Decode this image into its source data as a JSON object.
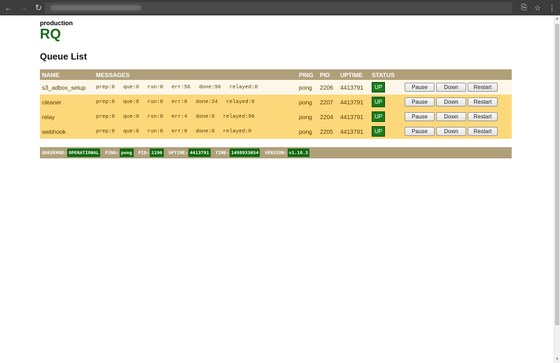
{
  "browser": {
    "back_icon": "←",
    "forward_icon": "→",
    "reload_icon": "↻",
    "translate_icon": "⎘",
    "star_icon": "☆",
    "menu_icon": "⋮"
  },
  "header": {
    "environment": "production",
    "brand": "RQ"
  },
  "section_title": "Queue List",
  "table": {
    "columns": {
      "name": "NAME",
      "messages": "MESSAGES",
      "ping": "PING",
      "pid": "PID",
      "uptime": "UPTIME",
      "status": "STATUS"
    },
    "button_labels": {
      "pause": "Pause",
      "down": "Down",
      "restart": "Restart"
    },
    "rows": [
      {
        "name": "s3_adbox_setup",
        "prep": "prep:0",
        "que": "que:0",
        "run": "run:0",
        "err": "err:56",
        "done": "done:96",
        "relayed": "relayed:0",
        "ping": "pong",
        "pid": "2206",
        "uptime": "4413791",
        "status": "UP"
      },
      {
        "name": "cleaner",
        "prep": "prep:0",
        "que": "que:0",
        "run": "run:0",
        "err": "err:0",
        "done": "done:24",
        "relayed": "relayed:0",
        "ping": "pong",
        "pid": "2207",
        "uptime": "4413791",
        "status": "UP"
      },
      {
        "name": "relay",
        "prep": "prep:0",
        "que": "que:0",
        "run": "run:0",
        "err": "err:4",
        "done": "done:0",
        "relayed": "relayed:96",
        "ping": "pong",
        "pid": "2204",
        "uptime": "4413791",
        "status": "UP"
      },
      {
        "name": "webhook",
        "prep": "prep:0",
        "que": "que:0",
        "run": "run:0",
        "err": "err:0",
        "done": "done:0",
        "relayed": "relayed:0",
        "ping": "pong",
        "pid": "2205",
        "uptime": "4413791",
        "status": "UP"
      }
    ]
  },
  "status_bar": {
    "queuemgr_label": "QUEUEMGR:",
    "queuemgr_value": "OPERATIONAL",
    "ping_label": "PING:",
    "ping_value": "pong",
    "pid_label": "PID:",
    "pid_value": "2190",
    "uptime_label": "UPTIME:",
    "uptime_value": "4413791",
    "time_label": "TIME:",
    "time_value": "1498933054",
    "version_label": "VERSION:",
    "version_value": "v1.18.3"
  },
  "colors": {
    "accent_green": "#1a6a1a",
    "header_tan": "#b0a07a",
    "row_orange": "#fdd87a",
    "row_light": "#fcf7e8",
    "status_green": "#1a7a1a"
  }
}
